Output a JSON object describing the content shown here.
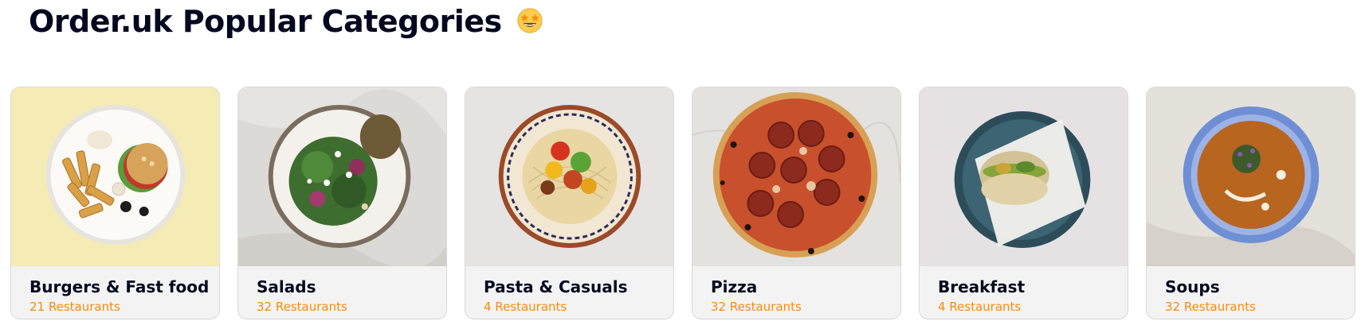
{
  "header": {
    "title": "Order.uk Popular Categories",
    "emoji_icon": "star-struck-emoji-icon"
  },
  "colors": {
    "heading": "#03081F",
    "accent": "#FC8A06",
    "card_bg": "#F3F3F3"
  },
  "categories": [
    {
      "name": "Burgers & Fast food",
      "count": "21 Restaurants",
      "image": "burger-fries-plate"
    },
    {
      "name": "Salads",
      "count": "32 Restaurants",
      "image": "salad-bowl"
    },
    {
      "name": "Pasta & Casuals",
      "count": "4 Restaurants",
      "image": "pasta-plate"
    },
    {
      "name": "Pizza",
      "count": "32 Restaurants",
      "image": "pepperoni-pizza"
    },
    {
      "name": "Breakfast",
      "count": "4 Restaurants",
      "image": "breakfast-bagel"
    },
    {
      "name": "Soups",
      "count": "32 Restaurants",
      "image": "soup-bowl"
    }
  ]
}
